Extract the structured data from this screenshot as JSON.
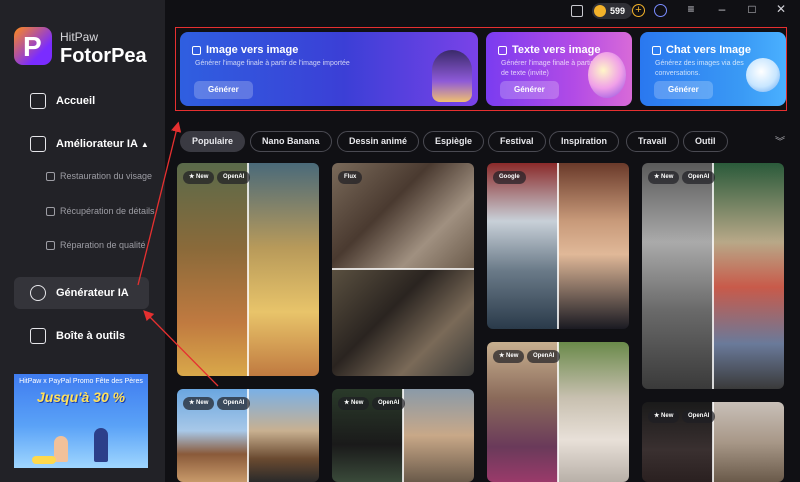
{
  "sidebar": {
    "brand_top": "HitPaw",
    "brand_main": "FotorPea",
    "nav": {
      "home": "Accueil",
      "enhancer": "Améliorateur IA",
      "generator": "Générateur IA",
      "toolbox": "Boîte à outils"
    },
    "sub_items": [
      "Restauration du visage",
      "Récupération de détails",
      "Réparation de qualité"
    ],
    "promo": {
      "top": "HitPaw x PayPal Promo Fête des Pères",
      "main": "Jusqu'à 30 %"
    }
  },
  "topbar": {
    "credits": "599"
  },
  "banners": [
    {
      "title": "Image vers image",
      "desc": "Générer l'image finale à partir de l'image importée",
      "button": "Générer"
    },
    {
      "title": "Texte vers image",
      "desc": "Générer l'image finale à partir de texte (invite)",
      "button": "Générer"
    },
    {
      "title": "Chat vers Image",
      "desc": "Générez des images via des conversations.",
      "button": "Générer"
    }
  ],
  "categories": [
    "Populaire",
    "Nano Banana",
    "Dessin animé",
    "Espiègle",
    "Festival",
    "Inspiration",
    "Travail",
    "Outil"
  ],
  "cards": {
    "tags": [
      "New",
      "OpenAI",
      "Flux",
      "Google",
      "New",
      "OpenAI",
      "New",
      "OpenAI",
      "New",
      "OpenAI",
      "New",
      "OpenAI"
    ]
  },
  "colors": {
    "accent_red": "#e63030",
    "sidebar_bg": "#222227",
    "main_bg": "#101014"
  }
}
